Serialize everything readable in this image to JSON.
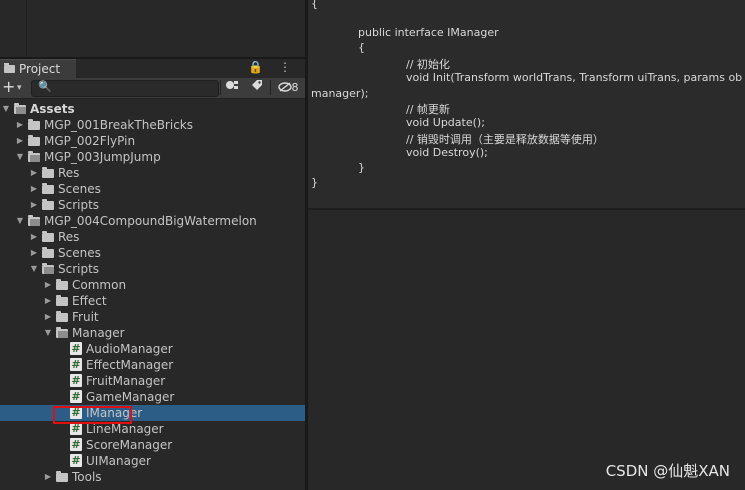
{
  "project_panel": {
    "tab_label": "Project",
    "tab_actions": "🔒 ⋮",
    "toolbar": {
      "add_label": "+",
      "dropdown_glyph": "▾",
      "search_placeholder": "",
      "search_glyph": "🔍",
      "hidden_count": "8"
    },
    "tree": [
      {
        "label": "Assets",
        "depth": 0,
        "kind": "folder-open",
        "expanded": true,
        "bold": true
      },
      {
        "label": "MGP_001BreakTheBricks",
        "depth": 1,
        "kind": "folder",
        "expanded": false
      },
      {
        "label": "MGP_002FlyPin",
        "depth": 1,
        "kind": "folder",
        "expanded": false
      },
      {
        "label": "MGP_003JumpJump",
        "depth": 1,
        "kind": "folder-open",
        "expanded": true
      },
      {
        "label": "Res",
        "depth": 2,
        "kind": "folder",
        "expanded": false
      },
      {
        "label": "Scenes",
        "depth": 2,
        "kind": "folder",
        "expanded": false
      },
      {
        "label": "Scripts",
        "depth": 2,
        "kind": "folder",
        "expanded": false
      },
      {
        "label": "MGP_004CompoundBigWatermelon",
        "depth": 1,
        "kind": "folder-open",
        "expanded": true
      },
      {
        "label": "Res",
        "depth": 2,
        "kind": "folder",
        "expanded": false
      },
      {
        "label": "Scenes",
        "depth": 2,
        "kind": "folder",
        "expanded": false
      },
      {
        "label": "Scripts",
        "depth": 2,
        "kind": "folder-open",
        "expanded": true
      },
      {
        "label": "Common",
        "depth": 3,
        "kind": "folder",
        "expanded": false
      },
      {
        "label": "Effect",
        "depth": 3,
        "kind": "folder",
        "expanded": false
      },
      {
        "label": "Fruit",
        "depth": 3,
        "kind": "folder",
        "expanded": false
      },
      {
        "label": "Manager",
        "depth": 3,
        "kind": "folder-open",
        "expanded": true
      },
      {
        "label": "AudioManager",
        "depth": 4,
        "kind": "script"
      },
      {
        "label": "EffectManager",
        "depth": 4,
        "kind": "script"
      },
      {
        "label": "FruitManager",
        "depth": 4,
        "kind": "script"
      },
      {
        "label": "GameManager",
        "depth": 4,
        "kind": "script"
      },
      {
        "label": "IManager",
        "depth": 4,
        "kind": "script",
        "selected": true
      },
      {
        "label": "LineManager",
        "depth": 4,
        "kind": "script"
      },
      {
        "label": "ScoreManager",
        "depth": 4,
        "kind": "script"
      },
      {
        "label": "UIManager",
        "depth": 4,
        "kind": "script"
      },
      {
        "label": "Tools",
        "depth": 3,
        "kind": "folder",
        "expanded": false
      }
    ]
  },
  "code_panel": {
    "lines": [
      {
        "text": "{",
        "indent": 0
      },
      {
        "text": "public interface IManager",
        "indent": 1
      },
      {
        "text": "{",
        "indent": 1
      },
      {
        "text": "// 初始化",
        "indent": 2
      },
      {
        "text": "void Init(Transform worldTrans, Transform uiTrans, params ob",
        "indent": 2
      },
      {
        "text": "manager);",
        "indent": 0
      },
      {
        "text": "// 帧更新",
        "indent": 2
      },
      {
        "text": "void Update();",
        "indent": 2
      },
      {
        "text": "// 销毁时调用（主要是释放数据等使用）",
        "indent": 2
      },
      {
        "text": "void Destroy();",
        "indent": 2
      },
      {
        "text": "}",
        "indent": 1
      },
      {
        "text": "}",
        "indent": 0
      }
    ]
  },
  "watermark": "CSDN @仙魁XAN"
}
